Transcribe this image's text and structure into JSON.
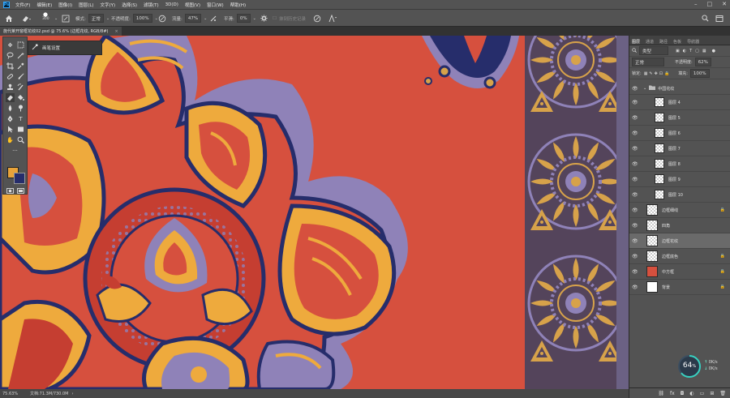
{
  "app": {
    "logo": "Ps"
  },
  "menubar": {
    "items": [
      "文件(F)",
      "编辑(E)",
      "图像(I)",
      "图层(L)",
      "文字(Y)",
      "选择(S)",
      "滤镜(T)",
      "3D(D)",
      "视图(V)",
      "窗口(W)",
      "帮助(H)"
    ],
    "window_controls": [
      "–",
      "□",
      "✕"
    ]
  },
  "options": {
    "brush_size": "300",
    "mode_label": "模式:",
    "mode_value": "正常",
    "opacity_label": "不透明度:",
    "opacity_value": "100%",
    "flow_label": "流量:",
    "flow_value": "47%",
    "smooth_label": "平滑:",
    "smooth_value": "0%",
    "history_label": "抹到历史记录"
  },
  "document": {
    "tab_title": "施代莱开窗框花纹02.psd @ 75.6% (边框花纹, RGB/8#)",
    "tab_close": "×"
  },
  "flyout": {
    "label": "画笔设置"
  },
  "statusbar": {
    "zoom": "75.63%",
    "doc_info": "文档:71.3M/730.0M"
  },
  "panel": {
    "tabs": [
      "图层",
      "通道",
      "路径",
      "色板",
      "导航器"
    ],
    "active_tab": "图层",
    "filter_label": "类型",
    "blend_mode": "正常",
    "opacity_label": "不透明度:",
    "opacity_value": "62%",
    "lock_label": "锁定:",
    "fill_label": "填充:",
    "fill_value": "100%",
    "group_name": "中国花纹",
    "layers": [
      {
        "name": "图层 4"
      },
      {
        "name": "图层 5"
      },
      {
        "name": "图层 6"
      },
      {
        "name": "图层 7"
      },
      {
        "name": "图层 8"
      },
      {
        "name": "图层 9"
      },
      {
        "name": "图层 10"
      },
      {
        "name": "边框细线"
      },
      {
        "name": "四角"
      },
      {
        "name": "边框花纹"
      },
      {
        "name": "边框底色"
      },
      {
        "name": "中方框"
      },
      {
        "name": "背景"
      }
    ]
  },
  "perf": {
    "value": "64",
    "unit": "%",
    "up": "0K/s",
    "down": "0K/s"
  },
  "colors": {
    "canvas": "#d6503e",
    "border_strip": "#54445b",
    "navy": "#262d6b",
    "gold": "#eeaa3d",
    "lavender": "#8f82b8"
  }
}
